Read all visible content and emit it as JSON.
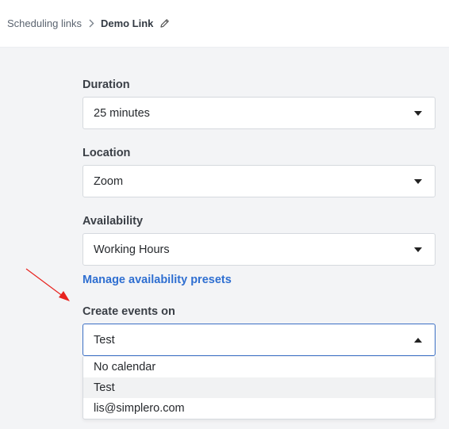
{
  "breadcrumb": {
    "parent": "Scheduling links",
    "current": "Demo Link"
  },
  "form": {
    "duration": {
      "label": "Duration",
      "value": "25 minutes"
    },
    "location": {
      "label": "Location",
      "value": "Zoom"
    },
    "availability": {
      "label": "Availability",
      "value": "Working Hours"
    },
    "manage_link": "Manage availability presets",
    "create_events": {
      "label": "Create events on",
      "value": "Test",
      "options": [
        "No calendar",
        "Test",
        "lis@simplero.com"
      ],
      "highlighted_option": "Test"
    }
  },
  "annotation": {
    "arrow_color": "#e8231f"
  },
  "colors": {
    "accent": "#2f6fd1",
    "focus_border": "#3b6fc4"
  }
}
